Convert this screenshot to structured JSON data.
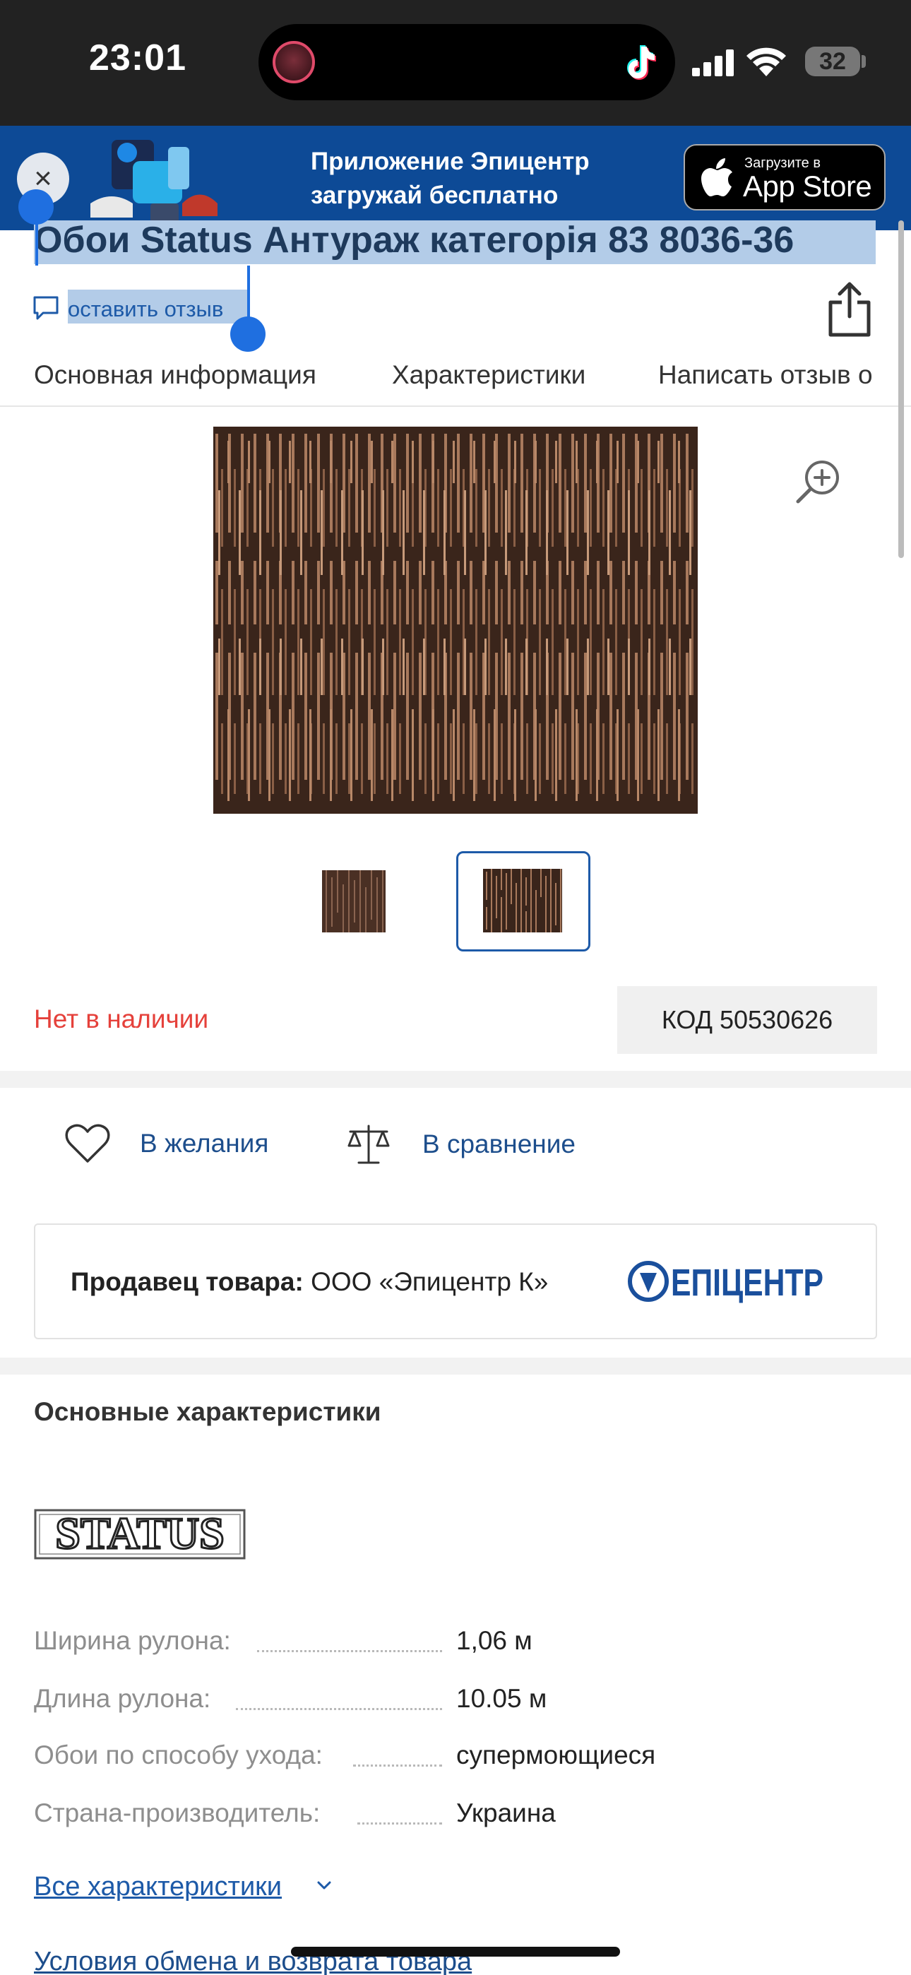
{
  "status_bar": {
    "time": "23:01",
    "battery": "32"
  },
  "banner": {
    "line1": "Приложение Эпицентр",
    "line2": "загружай бесплатно",
    "appstore_small": "Загрузите в",
    "appstore_big": "App Store"
  },
  "product": {
    "title": "Обои Status Антураж категорія 83 8036-36",
    "review_link": "оставить отзыв",
    "availability": "Нет в наличии",
    "code": "КОД 50530626"
  },
  "tabs": [
    "Основная информация",
    "Характеристики",
    "Написать отзыв о"
  ],
  "actions": {
    "wishlist": "В желания",
    "compare": "В сравнение"
  },
  "seller": {
    "label": "Продавец товара:",
    "name": "ООО «Эпицентр К»",
    "logo_text": "ЕПІЦЕНТР"
  },
  "specs": {
    "section_title": "Основные характеристики",
    "brand_logo_text": "STATUS",
    "rows": [
      {
        "name": "Ширина рулона:",
        "value": "1,06 м"
      },
      {
        "name": "Длина рулона:",
        "value": "10.05 м"
      },
      {
        "name": "Обои по способу ухода:",
        "value": "супермоющиеся"
      },
      {
        "name": "Страна-производитель:",
        "value": "Украина"
      }
    ],
    "all_link": "Все характеристики"
  },
  "footer": {
    "exchange_link": "Условия обмена и возврата товара"
  },
  "colors": {
    "brand_blue": "#0d4a96",
    "link_blue": "#1d5aa8",
    "out_of_stock": "#e5413b",
    "selection": "#b3cce8"
  }
}
